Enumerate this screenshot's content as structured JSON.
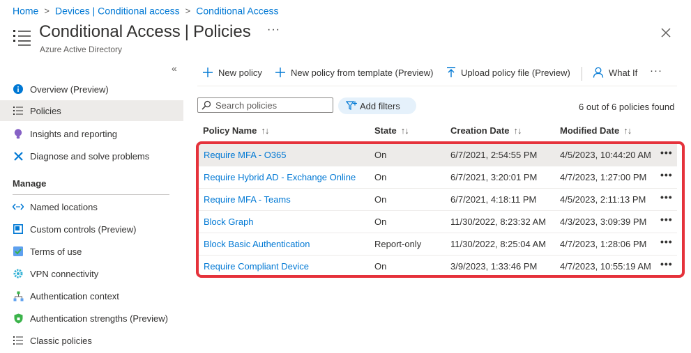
{
  "breadcrumb": [
    "Home",
    "Devices | Conditional access",
    "Conditional Access"
  ],
  "header": {
    "title": "Conditional Access",
    "title_sep": "|",
    "subtitle_title": "Policies",
    "subtitle": "Azure Active Directory",
    "more": "···"
  },
  "sidebar": {
    "collapse": "«",
    "items": [
      {
        "label": "Overview (Preview)",
        "icon": "info-icon"
      },
      {
        "label": "Policies",
        "icon": "list-icon"
      },
      {
        "label": "Insights and reporting",
        "icon": "lightbulb-icon"
      },
      {
        "label": "Diagnose and solve problems",
        "icon": "wrench-icon"
      }
    ],
    "manage_header": "Manage",
    "manage_items": [
      {
        "label": "Named locations",
        "icon": "code-arrows-icon"
      },
      {
        "label": "Custom controls (Preview)",
        "icon": "custom-controls-icon"
      },
      {
        "label": "Terms of use",
        "icon": "terms-icon"
      },
      {
        "label": "VPN connectivity",
        "icon": "gear-icon"
      },
      {
        "label": "Authentication context",
        "icon": "hierarchy-icon"
      },
      {
        "label": "Authentication strengths (Preview)",
        "icon": "shield-icon"
      },
      {
        "label": "Classic policies",
        "icon": "list-icon"
      }
    ]
  },
  "toolbar": {
    "new_policy": "New policy",
    "new_from_template": "New policy from template (Preview)",
    "upload": "Upload policy file (Preview)",
    "what_if": "What If",
    "more": "···"
  },
  "filter_bar": {
    "search_placeholder": "Search policies",
    "add_filters": "Add filters",
    "count": "6 out of 6 policies found"
  },
  "table": {
    "columns": [
      "Policy Name",
      "State",
      "Creation Date",
      "Modified Date"
    ],
    "sort_glyph": "↑↓",
    "rows": [
      {
        "name": "Require MFA - O365",
        "state": "On",
        "created": "6/7/2021, 2:54:55 PM",
        "modified": "4/5/2023, 10:44:20 AM"
      },
      {
        "name": "Require Hybrid AD - Exchange Online",
        "state": "On",
        "created": "6/7/2021, 3:20:01 PM",
        "modified": "4/7/2023, 1:27:00 PM"
      },
      {
        "name": "Require MFA - Teams",
        "state": "On",
        "created": "6/7/2021, 4:18:11 PM",
        "modified": "4/5/2023, 2:11:13 PM"
      },
      {
        "name": "Block Graph",
        "state": "On",
        "created": "11/30/2022, 8:23:32 AM",
        "modified": "4/3/2023, 3:09:39 PM"
      },
      {
        "name": "Block Basic Authentication",
        "state": "Report-only",
        "created": "11/30/2022, 8:25:04 AM",
        "modified": "4/7/2023, 1:28:06 PM"
      },
      {
        "name": "Require Compliant Device",
        "state": "On",
        "created": "3/9/2023, 1:33:46 PM",
        "modified": "4/7/2023, 10:55:19 AM"
      }
    ],
    "row_more": "•••"
  },
  "colors": {
    "accent": "#0078d4",
    "highlight": "#e5323b",
    "selected_bg": "#edebe9"
  }
}
